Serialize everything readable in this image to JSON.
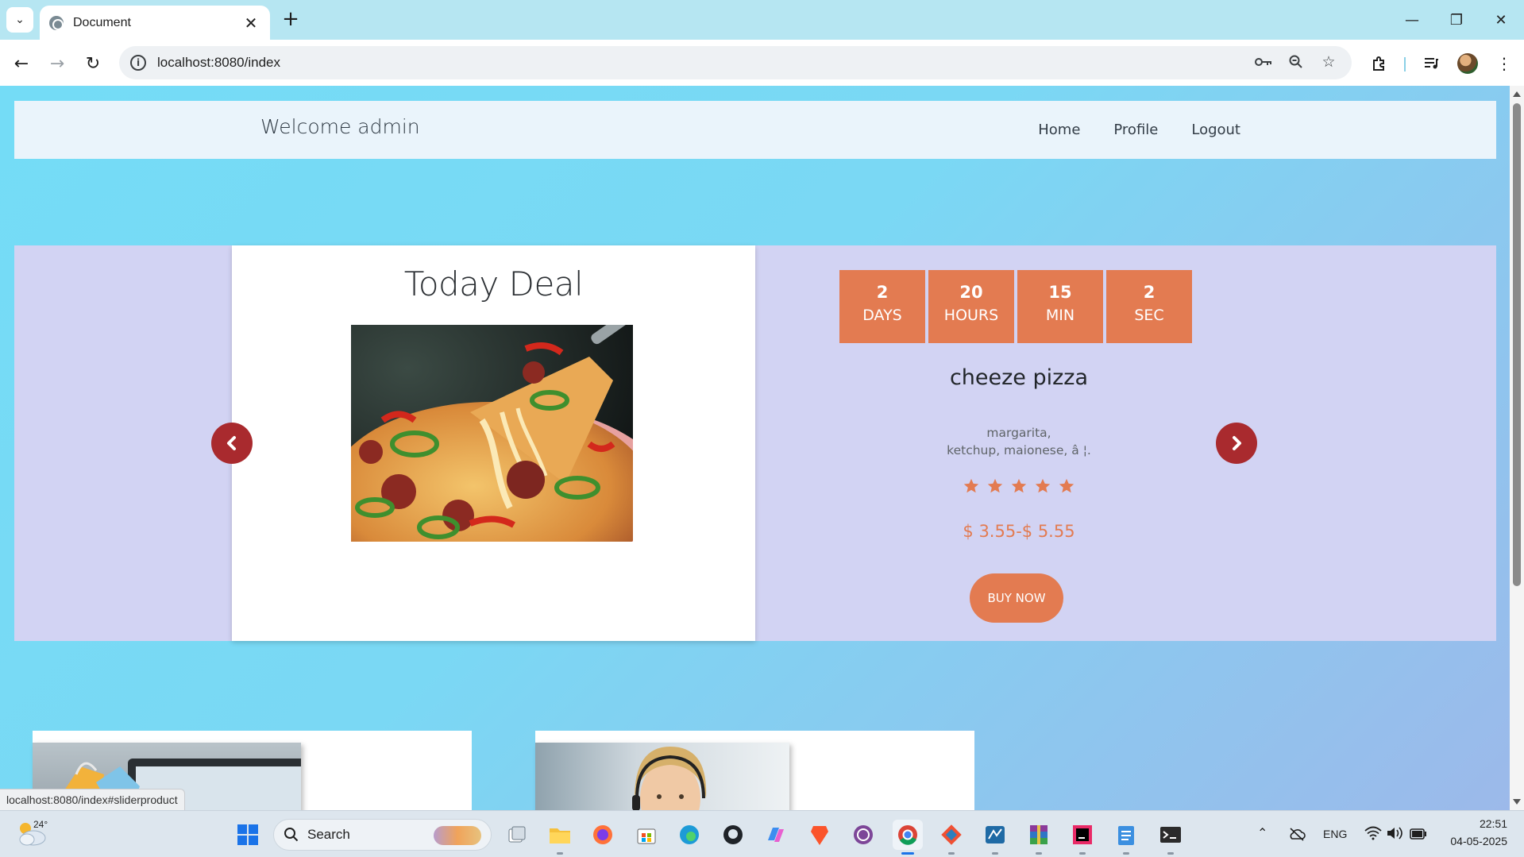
{
  "browser": {
    "tab_title": "Document",
    "url": "localhost:8080/index",
    "status_url": "localhost:8080/index#sliderproduct"
  },
  "header": {
    "welcome": "Welcome admin",
    "nav": [
      "Home",
      "Profile",
      "Logout"
    ]
  },
  "slider": {
    "title": "Today Deal",
    "countdown": [
      {
        "value": "2",
        "unit": "DAYS"
      },
      {
        "value": "20",
        "unit": "HOURS"
      },
      {
        "value": "15",
        "unit": "MIN"
      },
      {
        "value": "2",
        "unit": "SEC"
      }
    ],
    "product_name": "cheeze pizza",
    "description_line1": "margarita,",
    "description_line2": "ketchup, maionese, â ¦.",
    "rating": 5,
    "price": "$ 3.55-$ 5.55",
    "buy_label": "BUY NOW"
  },
  "taskbar": {
    "search_label": "Search",
    "weather_temp": "24°",
    "language": "ENG",
    "time": "22:51",
    "date": "04-05-2025"
  },
  "colors": {
    "accent": "#e37b51",
    "arrow": "#a92a2e",
    "slider_bg": "#d2d3f3",
    "header_bg": "#eaf4fb"
  }
}
